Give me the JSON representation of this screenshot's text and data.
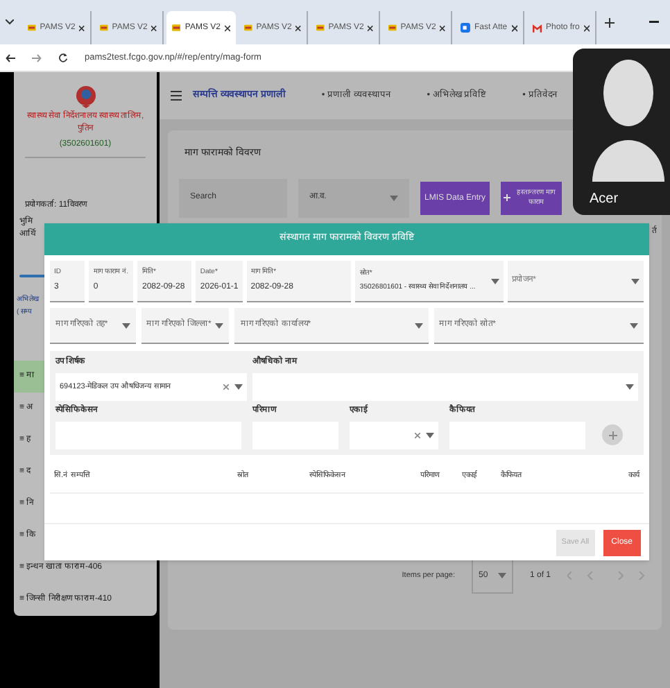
{
  "browser": {
    "tabs": [
      {
        "title": "PAMS V2",
        "selected": false,
        "kind": "site"
      },
      {
        "title": "PAMS V2",
        "selected": false,
        "kind": "site"
      },
      {
        "title": "PAMS V2",
        "selected": true,
        "kind": "site"
      },
      {
        "title": "PAMS V2",
        "selected": false,
        "kind": "site"
      },
      {
        "title": "PAMS V2",
        "selected": false,
        "kind": "site"
      },
      {
        "title": "PAMS V2",
        "selected": false,
        "kind": "site"
      },
      {
        "title": "Fast Atte",
        "selected": false,
        "kind": "meet"
      },
      {
        "title": "Photo fro",
        "selected": false,
        "kind": "mail"
      }
    ],
    "address": "pams2test.fcgo.gov.np/#/rep/entry/mag-form"
  },
  "sidebar": {
    "org_name": "स्वास्थ्य सेवा निर्देशनालय स्वास्थ्य तालिम, पुतिन",
    "org_code": "(3502601601)",
    "user": "प्रयोगकर्ता: 11विवरण",
    "fragments": [
      "भुमि",
      "आर्थि"
    ],
    "section": [
      "अभिलेख",
      "( सम्प"
    ],
    "items": [
      {
        "label": "≡ मा",
        "selected": true
      },
      {
        "label": "≡ अ",
        "selected": false
      },
      {
        "label": "≡ ह",
        "selected": false
      },
      {
        "label": "≡ द",
        "selected": false
      },
      {
        "label": "≡ नि",
        "selected": false
      },
      {
        "label": "≡ कि",
        "selected": false
      },
      {
        "label": "≡ इन्धन खाता फाराम-406",
        "selected": false
      },
      {
        "label": "≡ जिन्सी निरीक्षण फाराम-410",
        "selected": false
      }
    ]
  },
  "nav": {
    "brand": "सम्पत्ति व्यवस्थापन प्रणाली",
    "items": [
      "• प्रणाली व्यवस्थापन",
      "• अभिलेख प्रविष्टि",
      "• प्रतिवेदन"
    ]
  },
  "card": {
    "title": "माग फारामको विवरण",
    "search": {
      "placeholder": "Search"
    },
    "year_select": "आ.व.",
    "lmis_button": "LMIS Data Entry",
    "add_button": "हस्तान्तरण माग फाराम",
    "right_fragment": "र्त"
  },
  "paginator": {
    "label": "Items per page:",
    "page_size": "50",
    "range": "1 of 1"
  },
  "modal": {
    "title": "संस्थागत माग फारामको विवरण प्रविष्टि",
    "fields": [
      {
        "label": "ID",
        "value": "3",
        "kind": "text"
      },
      {
        "label": "माग फाराम नं.",
        "value": "0",
        "kind": "text"
      },
      {
        "label": "मिति*",
        "value": "2082-09-28",
        "kind": "text"
      },
      {
        "label": "Date*",
        "value": "2026-01-1",
        "kind": "text"
      },
      {
        "label": "माग मिति*",
        "value": "2082-09-28",
        "kind": "text"
      },
      {
        "label": "स्रोत*",
        "value": "35026801601 - स्वास्थ्य सेवा निर्देशनालय ...",
        "kind": "select"
      },
      {
        "placeholder": "प्रयोजन*",
        "kind": "select"
      }
    ],
    "selects": [
      {
        "placeholder": "माग गरिएको तह*"
      },
      {
        "placeholder": "माग गरिएको जिल्ला*"
      },
      {
        "placeholder": "माग गरिएको कार्यालय*"
      },
      {
        "placeholder": "माग गरिएको स्रोत*"
      }
    ],
    "subhead_label": "उप शिर्षक",
    "subhead_value": "694123-मेडिकल उप औषधिजन्य सामान",
    "medicine_label": "औषधिको नाम",
    "item_fields": [
      {
        "label": "स्पेसिफिकेसन",
        "kind": "text"
      },
      {
        "label": "परिमाण",
        "kind": "text"
      },
      {
        "label": "एकाई",
        "kind": "select"
      },
      {
        "label": "कैफियत",
        "kind": "text"
      }
    ],
    "columns": [
      "सि.नं",
      "सम्पत्ति",
      "स्रोत",
      "स्पेसिफिकेसन",
      "परिमाण",
      "एकाई",
      "कैफियत",
      "कार्य"
    ],
    "save_button": {
      "label": "Save All",
      "disabled": true
    },
    "close_button": "Close"
  },
  "video_tile": {
    "name": "Acer"
  }
}
